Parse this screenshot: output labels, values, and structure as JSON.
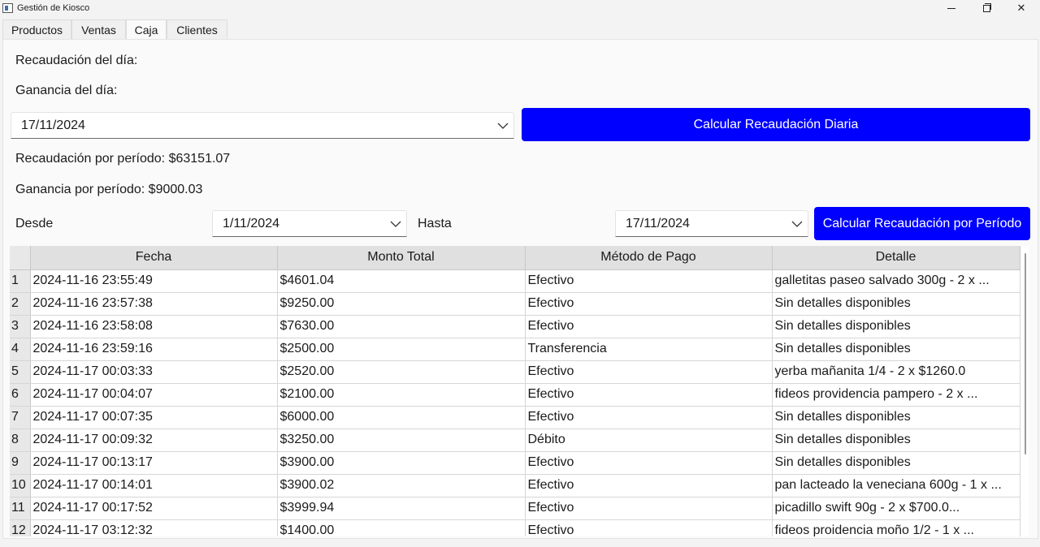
{
  "window": {
    "title": "Gestión de Kiosco",
    "minimize_glyph": "minimize-icon",
    "maximize_glyph": "restore-icon",
    "close_glyph": "✕"
  },
  "tabs": [
    {
      "label": "Productos"
    },
    {
      "label": "Ventas"
    },
    {
      "label": "Caja"
    },
    {
      "label": "Clientes"
    }
  ],
  "active_tab": "Caja",
  "caja": {
    "recaudacion_dia_label": "Recaudación del día:",
    "ganancia_dia_label": "Ganancia del día:",
    "fecha_diaria": "17/11/2024",
    "calcular_diaria_label": "Calcular Recaudación Diaria",
    "recaudacion_periodo_label": "Recaudación por período: $63151.07",
    "ganancia_periodo_label": "Ganancia por período: $9000.03",
    "desde_label": "Desde",
    "desde_value": "1/11/2024",
    "hasta_label": "Hasta",
    "hasta_value": "17/11/2024",
    "calcular_periodo_label": "Calcular Recaudación por Período",
    "accent_color": "#0000ff"
  },
  "table": {
    "columns": [
      "Fecha",
      "Monto Total",
      "Método de Pago",
      "Detalle"
    ],
    "rows": [
      {
        "n": "1",
        "fecha": "2024-11-16 23:55:49",
        "monto": "$4601.04",
        "metodo": "Efectivo",
        "detalle": "galletitas paseo salvado 300g - 2 x ..."
      },
      {
        "n": "2",
        "fecha": "2024-11-16 23:57:38",
        "monto": "$9250.00",
        "metodo": "Efectivo",
        "detalle": "Sin detalles disponibles"
      },
      {
        "n": "3",
        "fecha": "2024-11-16 23:58:08",
        "monto": "$7630.00",
        "metodo": "Efectivo",
        "detalle": "Sin detalles disponibles"
      },
      {
        "n": "4",
        "fecha": "2024-11-16 23:59:16",
        "monto": "$2500.00",
        "metodo": "Transferencia",
        "detalle": "Sin detalles disponibles"
      },
      {
        "n": "5",
        "fecha": "2024-11-17 00:03:33",
        "monto": "$2520.00",
        "metodo": "Efectivo",
        "detalle": "yerba mañanita 1/4 - 2 x $1260.0"
      },
      {
        "n": "6",
        "fecha": "2024-11-17 00:04:07",
        "monto": "$2100.00",
        "metodo": "Efectivo",
        "detalle": "fideos providencia pampero - 2 x ..."
      },
      {
        "n": "7",
        "fecha": "2024-11-17 00:07:35",
        "monto": "$6000.00",
        "metodo": "Efectivo",
        "detalle": "Sin detalles disponibles"
      },
      {
        "n": "8",
        "fecha": "2024-11-17 00:09:32",
        "monto": "$3250.00",
        "metodo": "Débito",
        "detalle": "Sin detalles disponibles"
      },
      {
        "n": "9",
        "fecha": "2024-11-17 00:13:17",
        "monto": "$3900.00",
        "metodo": "Efectivo",
        "detalle": "Sin detalles disponibles"
      },
      {
        "n": "10",
        "fecha": "2024-11-17 00:14:01",
        "monto": "$3900.02",
        "metodo": "Efectivo",
        "detalle": "pan lacteado la veneciana 600g - 1 x ..."
      },
      {
        "n": "11",
        "fecha": "2024-11-17 00:17:52",
        "monto": "$3999.94",
        "metodo": "Efectivo",
        "detalle": "picadillo swift 90g - 2 x $700.0..."
      },
      {
        "n": "12",
        "fecha": "2024-11-17 03:12:32",
        "monto": "$1400.00",
        "metodo": "Efectivo",
        "detalle": "fideos proidencia moño 1/2 - 1 x ..."
      }
    ]
  }
}
